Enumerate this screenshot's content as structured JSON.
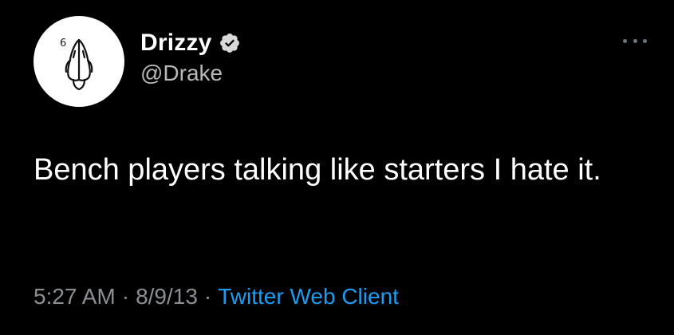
{
  "tweet": {
    "display_name": "Drizzy",
    "handle": "@Drake",
    "text": "Bench players talking like starters I hate it.",
    "time": "5:27 AM",
    "separator": "·",
    "date": "8/9/13",
    "client": "Twitter Web Client",
    "avatar_icon": "praying-hands-icon",
    "avatar_digit": "6",
    "verified_icon": "verified-badge-icon",
    "more_icon": "more-options-icon"
  },
  "colors": {
    "background": "#000000",
    "name": "#ffffff",
    "handle": "#b7b9bb",
    "meta": "#8b8f93",
    "link": "#1d9bf0"
  }
}
